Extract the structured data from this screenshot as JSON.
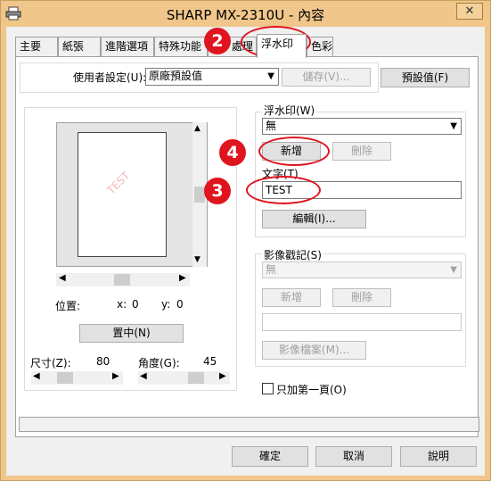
{
  "window": {
    "title": "SHARP MX-2310U - 內容",
    "close_glyph": "✕"
  },
  "tabs": [
    {
      "label": "主要"
    },
    {
      "label": "紙張"
    },
    {
      "label": "進階選項"
    },
    {
      "label": "特殊功能"
    },
    {
      "label": "處理"
    },
    {
      "label": "浮水印"
    },
    {
      "label": "色彩"
    }
  ],
  "user_settings": {
    "label": "使用者設定(U):",
    "value": "原廠預設值",
    "save_label": "儲存(V)...",
    "defaults_label": "預設值(F)"
  },
  "preview": {
    "watermark_text": "TEST",
    "position_label": "位置:",
    "x_label": "x:",
    "x_value": "0",
    "y_label": "y:",
    "y_value": "0",
    "center_label": "置中(N)",
    "size_label": "尺寸(Z):",
    "size_value": "80",
    "angle_label": "角度(G):",
    "angle_value": "45"
  },
  "watermark": {
    "label": "浮水印(W)",
    "value": "無",
    "add_label": "新增",
    "delete_label": "刪除",
    "text_label": "文字(T)",
    "text_value": "TEST",
    "edit_label": "編輯(I)..."
  },
  "image_stamp": {
    "label": "影像戳記(S)",
    "value": "無",
    "add_label": "新增",
    "delete_label": "刪除",
    "file_label": "影像檔案(M)..."
  },
  "first_page_only": {
    "label": "只加第一頁(O)",
    "checked": false
  },
  "buttons": {
    "ok": "確定",
    "cancel": "取消",
    "help": "說明"
  },
  "annotations": [
    {
      "number": "2"
    },
    {
      "number": "4"
    },
    {
      "number": "3"
    }
  ],
  "colors": {
    "annotation": "#e0141e",
    "title_bar": "#f0c68a"
  }
}
